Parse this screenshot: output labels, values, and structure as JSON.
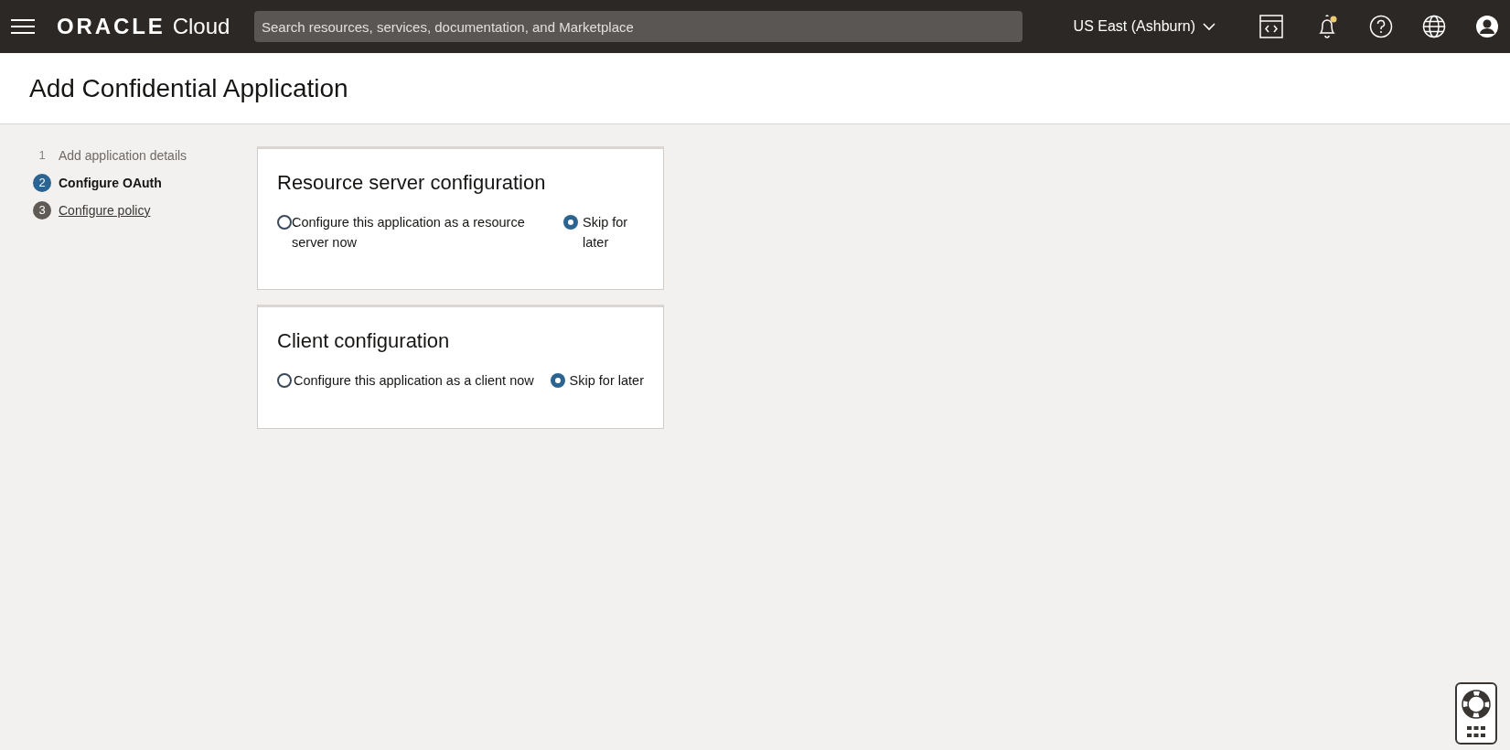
{
  "header": {
    "logo": "ORACLE",
    "logo_suffix": "Cloud",
    "search": {
      "placeholder": "Search resources, services, documentation, and Marketplace"
    },
    "region": "US East (Ashburn)",
    "notification_dot": true
  },
  "page_title": "Add Confidential Application",
  "steps": [
    {
      "number": "1",
      "label": "Add application details",
      "kind": "visited",
      "selected": false
    },
    {
      "number": "2",
      "label": "Configure OAuth",
      "kind": "current",
      "selected": true
    },
    {
      "number": "3",
      "label": "Configure policy",
      "kind": "link",
      "selected": false
    }
  ],
  "sections": [
    {
      "title": "Resource server configuration",
      "options": [
        {
          "label": "Configure this application as a resource server now",
          "selected": false
        },
        {
          "label": "Skip for later",
          "selected": true
        }
      ]
    },
    {
      "title": "Client configuration",
      "options": [
        {
          "label": "Configure this application as a client now",
          "selected": false
        },
        {
          "label": "Skip for later",
          "selected": true
        }
      ]
    }
  ]
}
